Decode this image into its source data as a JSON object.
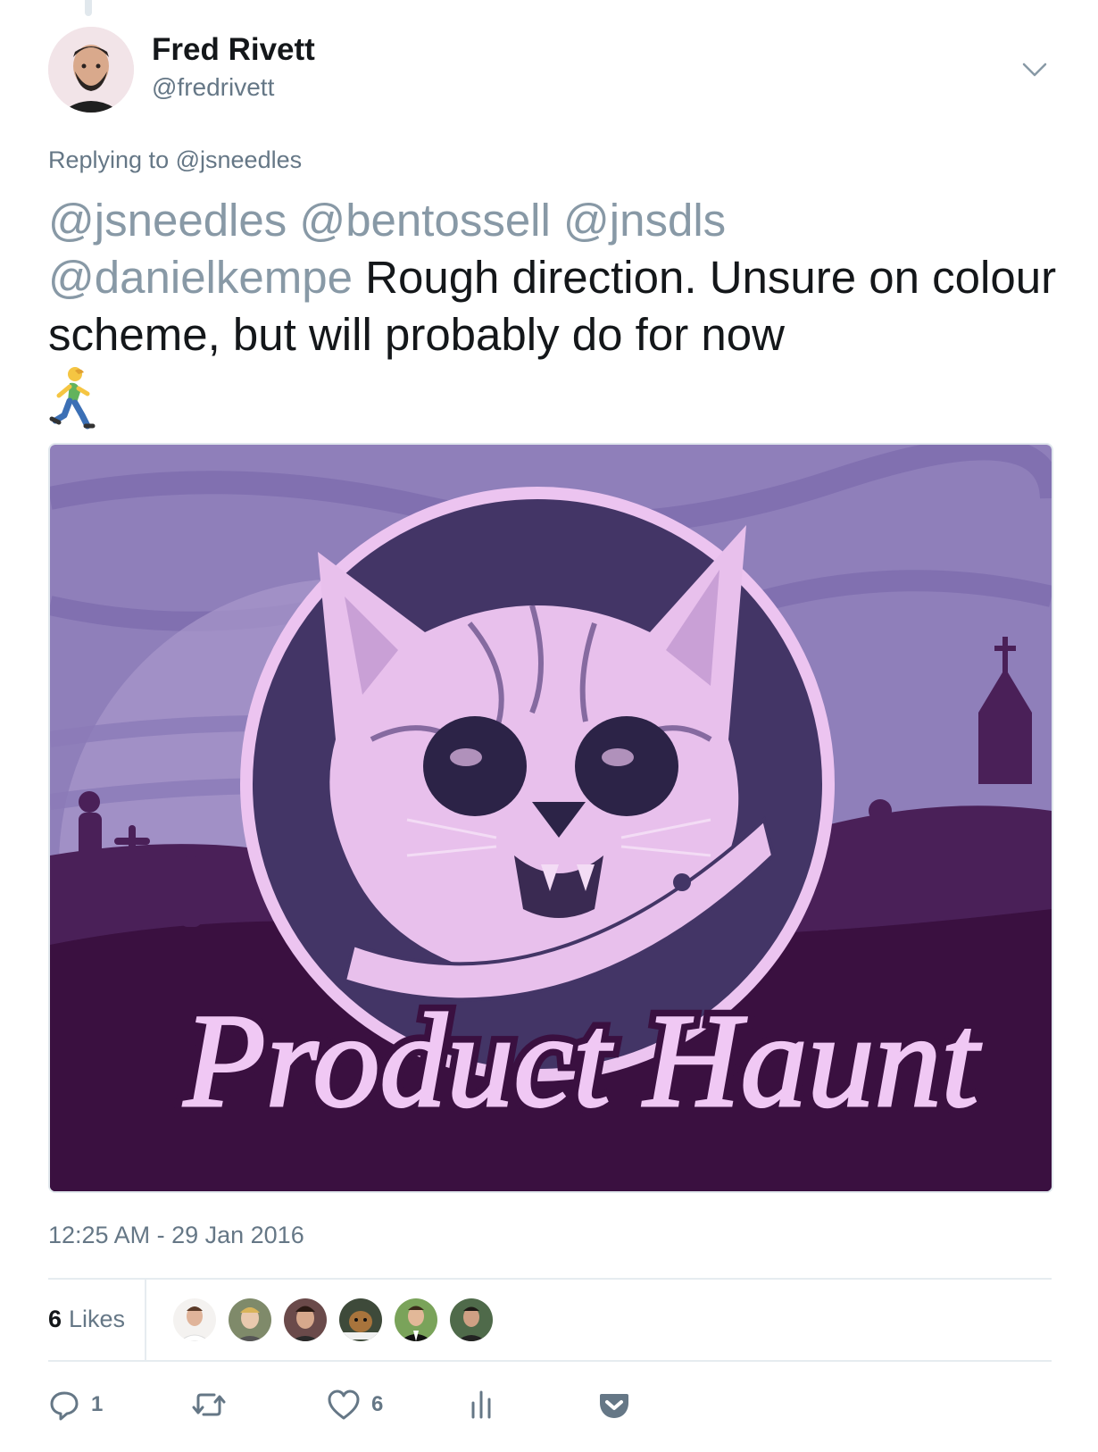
{
  "tweet": {
    "author_name": "Fred Rivett",
    "author_handle": "@fredrivett",
    "replying_prefix": "Replying to",
    "replying_to": "@jsneedles",
    "mentions_line": "@jsneedles @bentossell @jnsdls",
    "mention_last": "@danielkempe",
    "body_text": " Rough direction. Unsure on colour scheme, but will probably do for now",
    "emoji": "runner-icon",
    "timestamp": "12:25 AM - 29 Jan 2016"
  },
  "media": {
    "logo_text": "Product Haunt",
    "palette": {
      "sky": "#8f7fba",
      "moon": "#a796c9",
      "ground": "#3a1040",
      "hills": "#4a2058",
      "circle": "#433566",
      "cat": "#f0c8f4",
      "outline": "#ecc4f0"
    }
  },
  "stats": {
    "likes_count": "6",
    "likes_label": "Likes",
    "likers": [
      "avatar-1",
      "avatar-2",
      "avatar-3",
      "avatar-4",
      "avatar-5",
      "avatar-6"
    ]
  },
  "actions": {
    "reply_count": "1",
    "like_count": "6"
  },
  "colors": {
    "text": "#14171a",
    "secondary": "#657786",
    "mention": "#8899a6",
    "divider": "#e6ecf0"
  }
}
